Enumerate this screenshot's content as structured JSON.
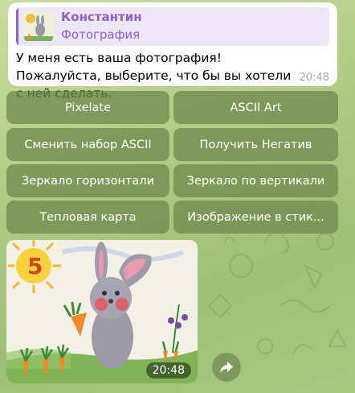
{
  "message": {
    "reply_author": "Константин",
    "reply_subtitle": "Фотография",
    "text": "У меня есть ваша фотография! Пожалуйста, выберите, что бы вы хотели с ней сделать.",
    "time": "20:48"
  },
  "keyboard": {
    "buttons": [
      "Pixelate",
      "ASCII Art",
      "Сменить набор ASCII",
      "Получить Негатив",
      "Зеркало горизонтали",
      "Зеркало по вертикали",
      "Тепловая карта",
      "Изображение в стик..."
    ]
  },
  "photo": {
    "time": "20:48",
    "drawing_digit": "5"
  },
  "icons": {
    "share": "share-arrow-icon"
  },
  "colors": {
    "accent": "#8e60c9",
    "button_bg": "#708c4e",
    "bubble": "#ffffff"
  }
}
